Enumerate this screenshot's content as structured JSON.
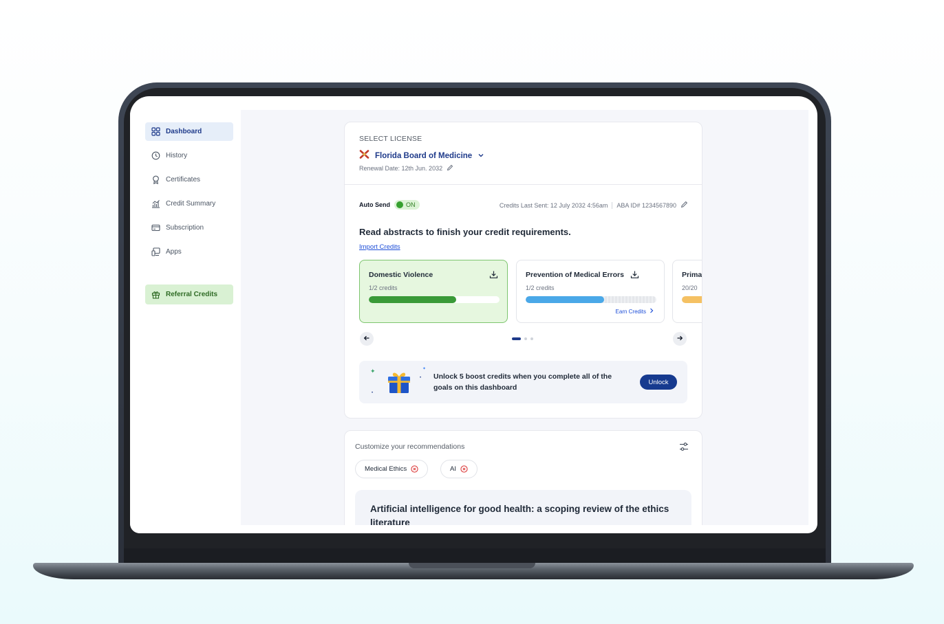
{
  "sidebar": {
    "items": [
      {
        "label": "Dashboard",
        "icon": "dashboard-grid-icon",
        "active": true
      },
      {
        "label": "History",
        "icon": "clock-icon"
      },
      {
        "label": "Certificates",
        "icon": "award-icon"
      },
      {
        "label": "Credit Summary",
        "icon": "bar-chart-icon"
      },
      {
        "label": "Subscription",
        "icon": "card-icon"
      },
      {
        "label": "Apps",
        "icon": "devices-icon"
      }
    ],
    "referral": {
      "label": "Referral Credits",
      "icon": "gift-icon"
    }
  },
  "license": {
    "section_label": "SELECT LICENSE",
    "name": "Florida Board of Medicine",
    "renewal": "Renewal Date: 12th Jun. 2032"
  },
  "auto_send": {
    "label": "Auto Send",
    "state": "ON",
    "last_sent": "Credits Last Sent: 12 July 2032 4:56am",
    "aba_id": "ABA ID# 1234567890"
  },
  "requirements": {
    "heading": "Read abstracts to finish your credit requirements.",
    "import_link": "Import Credits",
    "cards": [
      {
        "title": "Domestic Violence",
        "credits": "1/2 credits",
        "progress": 0.67,
        "color": "#3a9a38",
        "complete": true,
        "action": ""
      },
      {
        "title": "Prevention of Medical Errors",
        "credits": "1/2 credits",
        "progress": 0.6,
        "color": "#4aa8e8",
        "complete": false,
        "action": "Earn Credits"
      },
      {
        "title": "Prima",
        "credits": "20/20",
        "progress": 1.0,
        "color": "#f5c163",
        "complete": false,
        "action": ""
      }
    ],
    "pager": {
      "pages": 3,
      "current": 1
    }
  },
  "boost": {
    "text": "Unlock 5 boost credits when you complete all of the goals on this dashboard",
    "button": "Unlock"
  },
  "recommendations": {
    "title": "Customize your recommendations",
    "chips": [
      "Medical Ethics",
      "AI"
    ],
    "article_title": "Artificial intelligence for good health: a scoping review of the ethics literature"
  },
  "colors": {
    "brand_navy": "#1e3a8a",
    "active_nav_bg": "#e6eef9",
    "referral_bg": "#d9f1d3",
    "chip_close": "#d92d2d"
  }
}
